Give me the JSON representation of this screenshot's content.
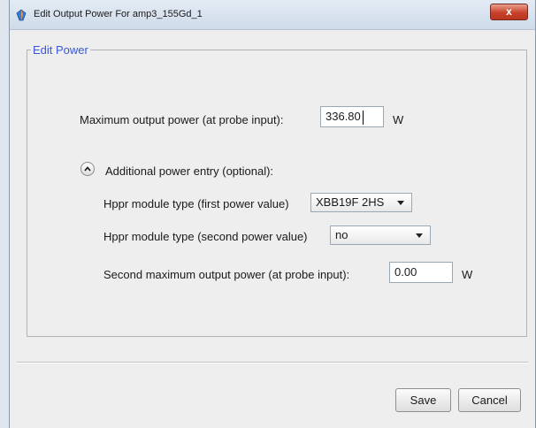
{
  "window": {
    "title": "Edit Output Power For amp3_155Gd_1",
    "close_symbol": "x"
  },
  "group": {
    "title": "Edit Power"
  },
  "max_power": {
    "label": "Maximum output power (at probe input):",
    "value": "336.80",
    "unit": "W"
  },
  "additional": {
    "label": "Additional power entry (optional):",
    "toggle_icon": "chevron-up-icon",
    "expanded": true
  },
  "hppr_first": {
    "label": "Hppr module type (first power value)",
    "selected": "XBB19F 2HS"
  },
  "hppr_second": {
    "label": "Hppr module type (second power value)",
    "selected": "no"
  },
  "second_max_power": {
    "label": "Second maximum output power (at probe input):",
    "value": "0.00",
    "unit": "W"
  },
  "buttons": {
    "save": "Save",
    "cancel": "Cancel"
  },
  "colors": {
    "group_title": "#3a57d6",
    "close_button": "#c8412a"
  }
}
